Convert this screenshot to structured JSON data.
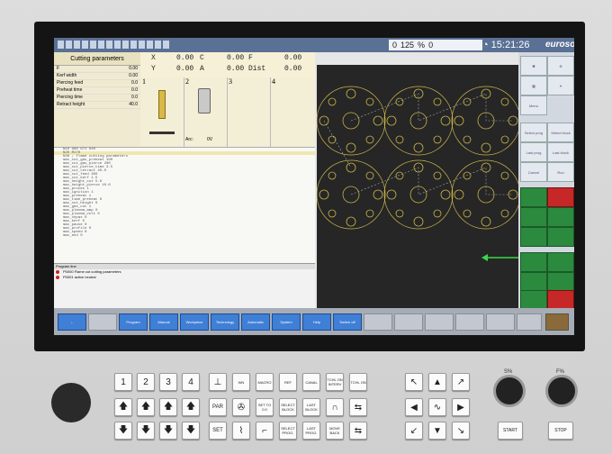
{
  "top_bar": {
    "speed_value": "125",
    "speed_unit": "%",
    "clock": "15:21:26",
    "logo": "eurosoft",
    "speed_left": "0",
    "speed_right": "0"
  },
  "params": {
    "title": "Cutting parameters",
    "rows": [
      {
        "label": "F",
        "value": "0.00"
      },
      {
        "label": "Kerf width",
        "value": "0.00"
      },
      {
        "label": "Piercing feed",
        "value": "0.0"
      },
      {
        "label": "Preheat time",
        "value": "0.0"
      },
      {
        "label": "Piercing time",
        "value": "0.0"
      },
      {
        "label": "Retract height",
        "value": "40.0"
      }
    ]
  },
  "coords": {
    "X": {
      "label": "X",
      "value": "0.00"
    },
    "Y": {
      "label": "Y",
      "value": "0.00"
    },
    "C": {
      "label": "C",
      "value": "0.00"
    },
    "A": {
      "label": "A",
      "value": "0.00"
    },
    "F": {
      "label": "F",
      "value": "0.00"
    },
    "Dist": {
      "label": "Dist",
      "value": "0.00"
    }
  },
  "tools": [
    {
      "num": "1"
    },
    {
      "num": "2"
    },
    {
      "num": "3"
    },
    {
      "num": "4"
    }
  ],
  "tool_labels": {
    "arc": "Arc:",
    "arc_val": "0V"
  },
  "messages": {
    "bar": "Program line",
    "items": [
      {
        "code": "P0000",
        "text": "Flame cut cutting parameters"
      },
      {
        "code": "P0001",
        "text": "active neutral"
      }
    ]
  },
  "side_buttons": [
    "Menu",
    "Select prog",
    "Select block",
    "Last prog",
    "Last block",
    "Cancel",
    "Run"
  ],
  "softkeys": [
    {
      "label": "←"
    },
    {
      "label": ""
    },
    {
      "label": "Program"
    },
    {
      "label": "Manual"
    },
    {
      "label": "Workpiece"
    },
    {
      "label": "Technology"
    },
    {
      "label": "Automatic"
    },
    {
      "label": "System"
    },
    {
      "label": "Help"
    },
    {
      "label": "Switch off"
    }
  ],
  "keypad": {
    "num": [
      "1",
      "2",
      "3",
      "4"
    ],
    "row1": [
      "WN",
      "MACRO",
      "REF",
      "CANAL",
      "TCHL ON INTERV",
      "TCHL ON"
    ],
    "row2": [
      "PAR",
      "SET TO 0.0",
      "SELECT BLOCK",
      "LAST BLOCK"
    ],
    "row3": [
      "SET",
      "SELECT PROG.",
      "LAST PROG.",
      "MOVE BACK"
    ],
    "knob1": "S%",
    "knob2": "F%",
    "start": "START",
    "stop": "STOP"
  },
  "editor_lines": [
    "N10 G90 G71 G40",
    "N20 M170",
    "N30 ; flame cutting parameters",
    "  mac_cut_gas_preheat 100",
    "  mac_cut_gas_pierce 200",
    "  mac_cut_pierce_time 3.5",
    "  mac_cut_retract 40.0",
    "  mac_cut_feed 300",
    "  mac_cut_kerf 1.5",
    "  mac_height_cut 5.0",
    "  mac_height_pierce 10.0",
    "  mac_proces 1",
    "  mac_ignition 1",
    "  mac_preheat 1",
    "  mac_time_preheat 0",
    "  mac_cut_height 0",
    "  mac_gas_cut 1",
    "  mac_plasma_amp 0",
    "  mac_plasma_volt 0",
    "  mac_chpas 0",
    "  mac_kerf 0",
    "  mac_pause 0",
    "  mac_profile 0",
    "  mac_speed 0",
    "  mac_end 0"
  ]
}
